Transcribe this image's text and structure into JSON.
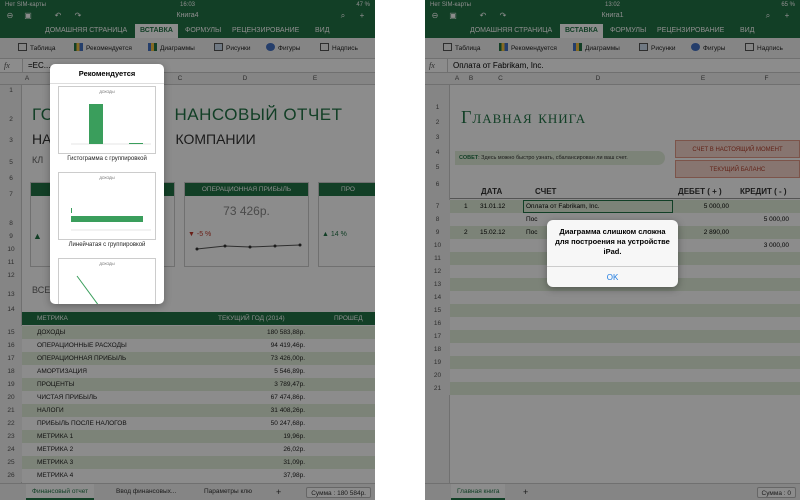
{
  "left": {
    "status": {
      "carrier": "Нет SIM-карты",
      "time": "16:03",
      "battery": "47 %"
    },
    "title": "Книга4",
    "tabs": [
      "ДОМАШНЯЯ СТРАНИЦА",
      "ВСТАВКА",
      "ФОРМУЛЫ",
      "РЕЦЕНЗИРОВАНИЕ",
      "ВИД"
    ],
    "ribbon": [
      "Таблица",
      "Рекомендуется",
      "Диаграммы",
      "Рисунки",
      "Фигуры",
      "Надпись"
    ],
    "formula": {
      "fx": "fx",
      "value": "=ЕС..."
    },
    "columns": [
      "A",
      "C",
      "D",
      "E"
    ],
    "title_frag": "ГО",
    "title_rest": "НАНСОВЫЙ ОТЧЕТ",
    "sub_frag": "НА",
    "sub_rest": "КОМПАНИИ",
    "klyu": "КЛ",
    "vse": "ВСЕ",
    "cards": [
      {
        "head": "",
        "value": ""
      },
      {
        "head": "ОПЕРАЦИОННАЯ ПРИБЫЛЬ",
        "value": "73 426р.",
        "delta": "-5 %"
      },
      {
        "head": "ПРО",
        "value": "",
        "delta": "14 %"
      }
    ],
    "table_header": {
      "metric": "МЕТРИКА",
      "year": "ТЕКУЩИЙ ГОД (2014)",
      "prev": "ПРОШЕД"
    },
    "rows": [
      {
        "n": "15",
        "name": "ДОХОДЫ",
        "val": "180 583,88р."
      },
      {
        "n": "16",
        "name": "ОПЕРАЦИОННЫЕ РАСХОДЫ",
        "val": "94 419,46р."
      },
      {
        "n": "17",
        "name": "ОПЕРАЦИОННАЯ ПРИБЫЛЬ",
        "val": "73 426,00р."
      },
      {
        "n": "18",
        "name": "АМОРТИЗАЦИЯ",
        "val": "5 546,89р."
      },
      {
        "n": "19",
        "name": "ПРОЦЕНТЫ",
        "val": "3 789,47р."
      },
      {
        "n": "20",
        "name": "ЧИСТАЯ ПРИБЫЛЬ",
        "val": "67 474,86р."
      },
      {
        "n": "21",
        "name": "НАЛОГИ",
        "val": "31 408,26р."
      },
      {
        "n": "22",
        "name": "ПРИБЫЛЬ ПОСЛЕ НАЛОГОВ",
        "val": "50 247,68р."
      },
      {
        "n": "23",
        "name": "МЕТРИКА 1",
        "val": "19,96р."
      },
      {
        "n": "24",
        "name": "МЕТРИКА 2",
        "val": "26,02р."
      },
      {
        "n": "25",
        "name": "МЕТРИКА 3",
        "val": "31,09р."
      },
      {
        "n": "26",
        "name": "МЕТРИКА 4",
        "val": "37,98р."
      }
    ],
    "row_nums_top": [
      "1",
      "2",
      "3",
      "5",
      "6",
      "7",
      "8",
      "9",
      "10",
      "11",
      "12",
      "13",
      "14"
    ],
    "popover": {
      "title": "Рекомендуется",
      "items": [
        {
          "thumb_title": "ДОХОДЫ",
          "caption": "Гистограмма с группировкой"
        },
        {
          "thumb_title": "ДОХОДЫ",
          "caption": "Линейчатая с группировкой"
        },
        {
          "thumb_title": "ДОХОДЫ",
          "caption": ""
        }
      ]
    },
    "sheet_tabs": [
      "Финансовый отчет",
      "Ввод финансовых...",
      "Параметры клю"
    ],
    "add": "+",
    "sum": "Сумма : 180 584р."
  },
  "right": {
    "status": {
      "carrier": "Нет SIM-карты",
      "time": "13:02",
      "battery": "65 %"
    },
    "title": "Книга1",
    "tabs": [
      "ДОМАШНЯЯ СТРАНИЦА",
      "ВСТАВКА",
      "ФОРМУЛЫ",
      "РЕЦЕНЗИРОВАНИЕ",
      "ВИД"
    ],
    "ribbon": [
      "Таблица",
      "Рекомендуется",
      "Диаграммы",
      "Рисунки",
      "Фигуры",
      "Надпись"
    ],
    "formula": {
      "fx": "fx",
      "value": "Оплата от Fabrikam, Inc."
    },
    "columns": [
      "A",
      "B",
      "C",
      "D",
      "E",
      "F"
    ],
    "book_title": "Главная книга",
    "tip_label": "СОВЕТ",
    "tip_text": ": Здесь можно быстро узнать, сбалансирован ли ваш счет.",
    "box1": "СЧЕТ В НАСТОЯЩИЙ МОМЕНТ",
    "box2": "ТЕКУЩИЙ БАЛАНС",
    "headers": {
      "date": "ДАТА",
      "account": "СЧЕТ",
      "debit": "ДЕБЕТ ( + )",
      "credit": "КРЕДИТ ( - )"
    },
    "entries": [
      {
        "n": "7",
        "num": "1",
        "date": "31.01.12",
        "account": "Оплата от Fabrikam, Inc.",
        "debit": "5 000,00",
        "credit": ""
      },
      {
        "n": "8",
        "num": "",
        "date": "",
        "account": "Пос",
        "debit": "",
        "credit": "5 000,00"
      },
      {
        "n": "9",
        "num": "2",
        "date": "15.02.12",
        "account": "Пос",
        "debit": "2 890,00",
        "credit": ""
      },
      {
        "n": "10",
        "num": "",
        "date": "",
        "account": "",
        "debit": "",
        "credit": "3 000,00"
      }
    ],
    "row_nums": [
      "1",
      "2",
      "3",
      "4",
      "5",
      "6",
      "11",
      "12",
      "13",
      "14",
      "15",
      "16",
      "17",
      "18",
      "19",
      "20",
      "21"
    ],
    "alert": {
      "message": "Диаграмма слишком сложна для построения на устройстве iPad.",
      "ok": "OK"
    },
    "sheet_tabs": [
      "Главная книга"
    ],
    "add": "+",
    "sum": "Сумма : 0"
  },
  "colors": {
    "excel_green": "#217346",
    "dim_overlay": "rgba(0,0,0,0.45)",
    "row_band": "#e2efda"
  }
}
